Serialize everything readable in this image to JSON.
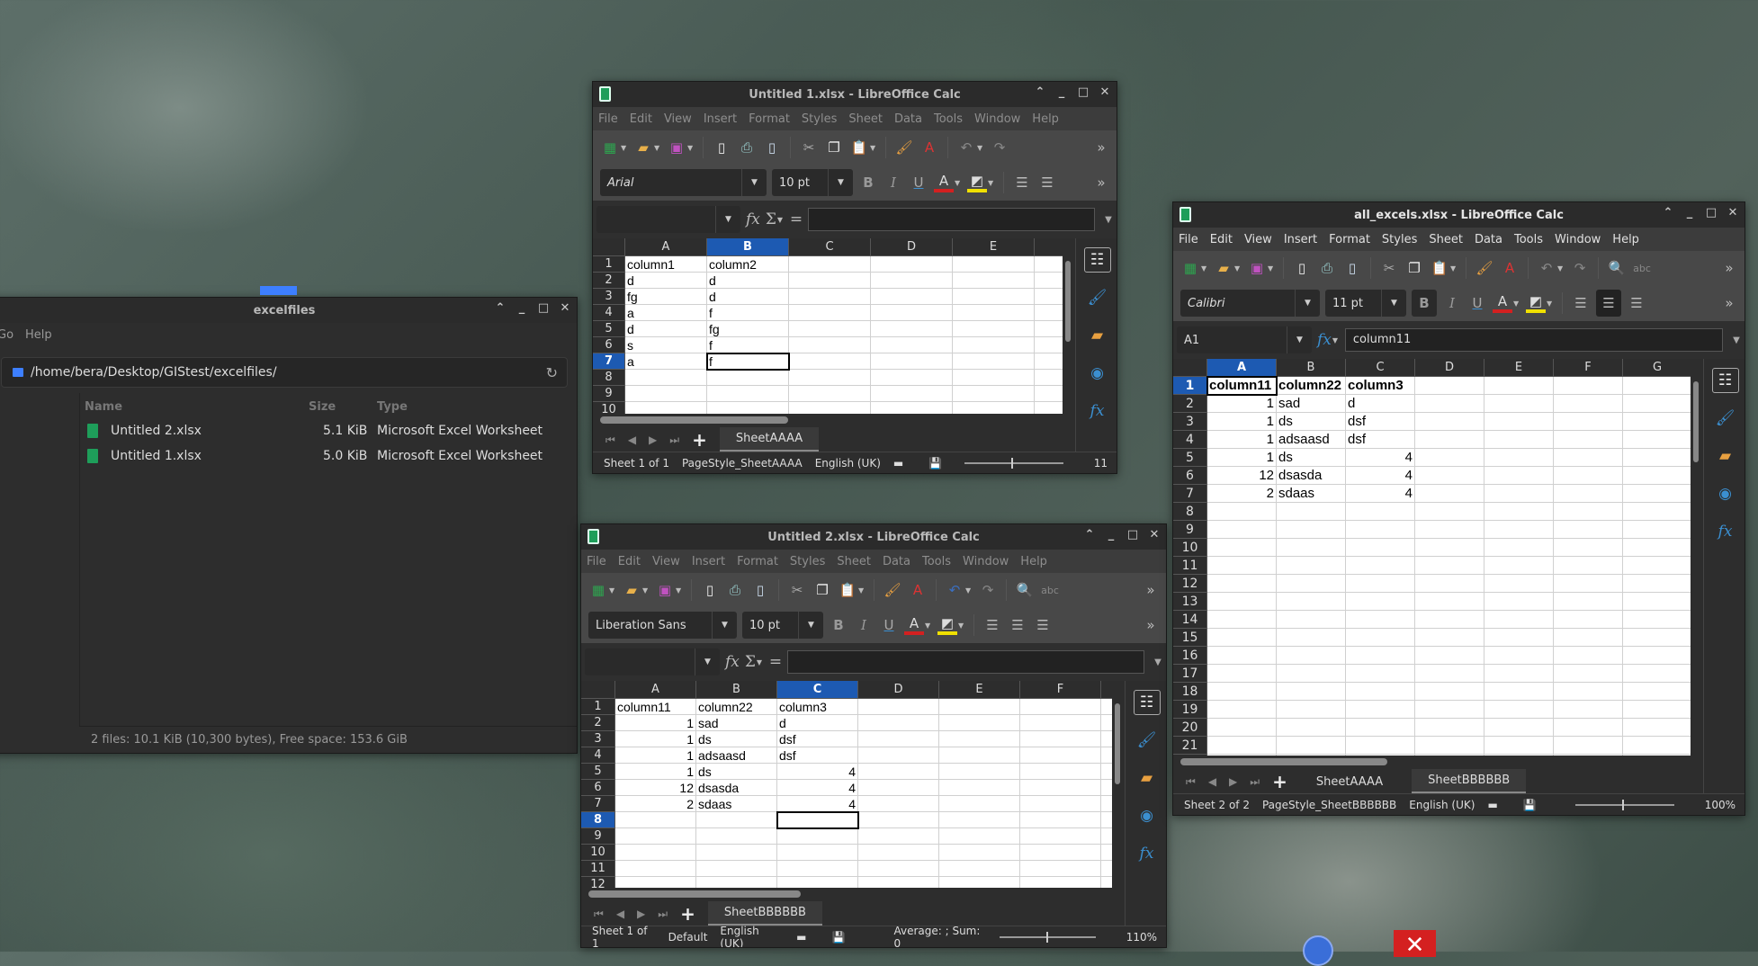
{
  "file_manager": {
    "title": "excelfiles",
    "menu": [
      "Go",
      "Help"
    ],
    "path": "/home/bera/Desktop/GIStest/excelfiles/",
    "columns": {
      "name": "Name",
      "size": "Size",
      "type": "Type"
    },
    "files": [
      {
        "name": "Untitled 2.xlsx",
        "size": "5.1  KiB",
        "type": "Microsoft Excel Worksheet"
      },
      {
        "name": "Untitled 1.xlsx",
        "size": "5.0  KiB",
        "type": "Microsoft Excel Worksheet"
      }
    ],
    "status": "2 files: 10.1  KiB (10,300 bytes), Free space: 153.6  GiB"
  },
  "calc_menu": [
    "File",
    "Edit",
    "View",
    "Insert",
    "Format",
    "Styles",
    "Sheet",
    "Data",
    "Tools",
    "Window",
    "Help"
  ],
  "windows": [
    {
      "title": "Untitled 1.xlsx - LibreOffice Calc",
      "font": "Arial",
      "font_size": "10 pt",
      "name_box": "",
      "formula": "",
      "columns": [
        "A",
        "B",
        "C",
        "D",
        "E"
      ],
      "active_cell": "B7",
      "cells": [
        [
          "column1",
          "column2"
        ],
        [
          "d",
          "d"
        ],
        [
          "fg",
          "d"
        ],
        [
          "a",
          "f"
        ],
        [
          "d",
          "fg"
        ],
        [
          "s",
          "f"
        ],
        [
          "a",
          "f"
        ]
      ],
      "tabs": [
        "SheetAAAA"
      ],
      "current_tab": "SheetAAAA",
      "status": [
        "Sheet 1 of 1",
        "PageStyle_SheetAAAA",
        "English (UK)"
      ],
      "summary": "",
      "zoom": "11"
    },
    {
      "title": "Untitled 2.xlsx - LibreOffice Calc",
      "font": "Liberation Sans",
      "font_size": "10 pt",
      "name_box": "",
      "formula": "",
      "columns": [
        "A",
        "B",
        "C",
        "D",
        "E",
        "F"
      ],
      "active_cell": "C8",
      "cells": [
        [
          "column11",
          "column22",
          "column3"
        ],
        [
          "1",
          "sad",
          "d"
        ],
        [
          "1",
          "ds",
          "dsf"
        ],
        [
          "1",
          "adsaasd",
          "dsf"
        ],
        [
          "1",
          "ds",
          "4"
        ],
        [
          "12",
          "dsasda",
          "4"
        ],
        [
          "2",
          "sdaas",
          "4"
        ]
      ],
      "tabs": [
        "SheetBBBBBB"
      ],
      "current_tab": "SheetBBBBBB",
      "status": [
        "Sheet 1 of 1",
        "Default",
        "English (UK)"
      ],
      "summary": "Average: ; Sum: 0",
      "zoom": "110%"
    },
    {
      "title": "all_excels.xlsx - LibreOffice Calc",
      "font": "Calibri",
      "font_size": "11 pt",
      "name_box": "A1",
      "formula": "column11",
      "columns": [
        "A",
        "B",
        "C",
        "D",
        "E",
        "F",
        "G"
      ],
      "active_cell": "A1",
      "cells": [
        [
          "column11",
          "column22",
          "column3"
        ],
        [
          "1",
          "sad",
          "d"
        ],
        [
          "1",
          "ds",
          "dsf"
        ],
        [
          "1",
          "adsaasd",
          "dsf"
        ],
        [
          "1",
          "ds",
          "4"
        ],
        [
          "12",
          "dsasda",
          "4"
        ],
        [
          "2",
          "sdaas",
          "4"
        ]
      ],
      "tabs": [
        "SheetAAAA",
        "SheetBBBBBB"
      ],
      "current_tab": "SheetBBBBBB",
      "status": [
        "Sheet 2 of 2",
        "PageStyle_SheetBBBBBB",
        "English (UK)"
      ],
      "summary": "",
      "zoom": "100%"
    }
  ],
  "colors": {
    "selection_header": "#1d5ab2",
    "sheet_icon": "#1e9e5a",
    "folder": "#3d7fff",
    "taskbar_close": "#d42020"
  }
}
